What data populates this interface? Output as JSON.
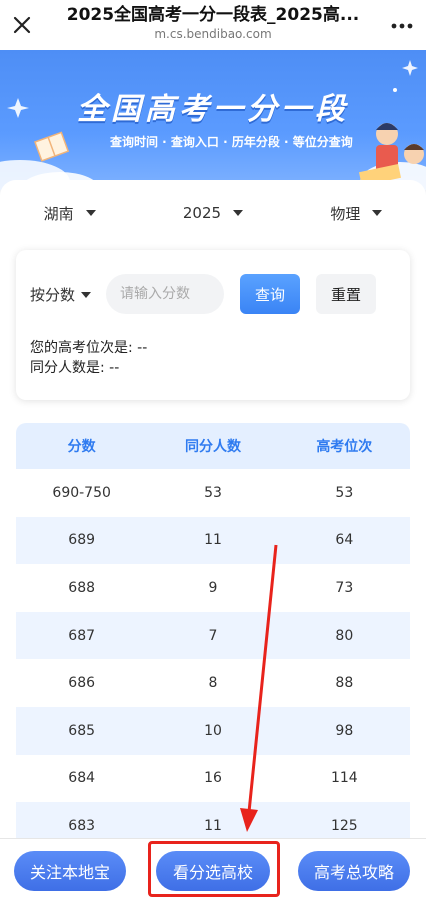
{
  "browser": {
    "title": "2025全国高考一分一段表_2025高...",
    "url": "m.cs.bendibao.com",
    "close_icon": "close-icon",
    "more_icon": "more-dots-icon"
  },
  "banner": {
    "title": "全国高考一分一段",
    "subtitle": "查询时间 · 查询入口 · 历年分段 · 等位分查询"
  },
  "filters": [
    {
      "label": "湖南"
    },
    {
      "label": "2025"
    },
    {
      "label": "物理"
    }
  ],
  "query": {
    "mode_label": "按分数",
    "input_placeholder": "请输入分数",
    "input_value": "",
    "query_button": "查询",
    "reset_button": "重置",
    "rank_line": "您的高考位次是: --",
    "same_line": "同分人数是: --"
  },
  "table": {
    "headers": [
      "分数",
      "同分人数",
      "高考位次"
    ],
    "rows": [
      [
        "690-750",
        "53",
        "53"
      ],
      [
        "689",
        "11",
        "64"
      ],
      [
        "688",
        "9",
        "73"
      ],
      [
        "687",
        "7",
        "80"
      ],
      [
        "686",
        "8",
        "88"
      ],
      [
        "685",
        "10",
        "98"
      ],
      [
        "684",
        "16",
        "114"
      ],
      [
        "683",
        "11",
        "125"
      ]
    ]
  },
  "bottom": {
    "follow": "关注本地宝",
    "choose_school": "看分选高校",
    "guide": "高考总攻略"
  },
  "colors": {
    "accent": "#3a84f5",
    "annotation": "#e8231c"
  }
}
